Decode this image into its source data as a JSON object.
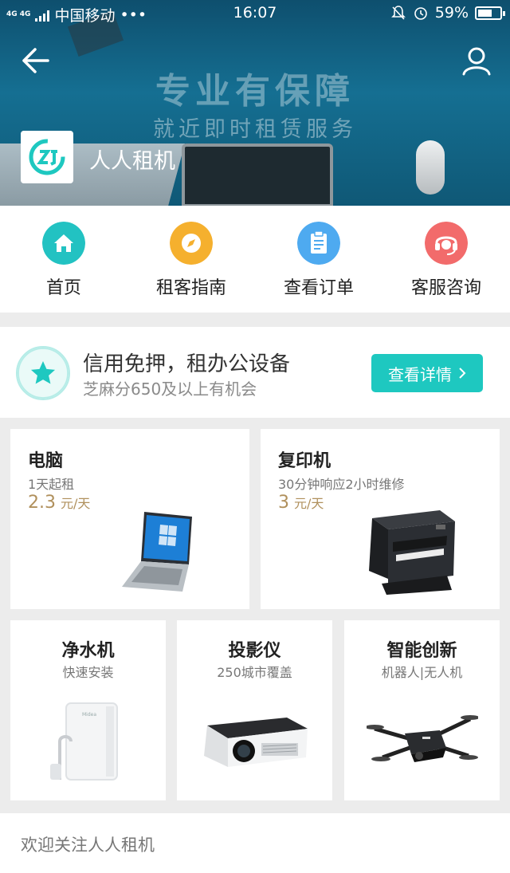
{
  "status_bar": {
    "network": "4G 4G",
    "carrier": "中国移动",
    "dots": "•••",
    "time": "16:07",
    "battery": "59%"
  },
  "banner": {
    "headline": "专业有保障",
    "subline": "就近即时租赁服务",
    "brand_name": "人人租机",
    "colors": {
      "accent": "#1ec8c0",
      "banner": "#156f92"
    }
  },
  "nav": [
    {
      "label": "首页",
      "icon": "home-icon",
      "color": "#22c2c2"
    },
    {
      "label": "租客指南",
      "icon": "compass-icon",
      "color": "#f5b02e"
    },
    {
      "label": "查看订单",
      "icon": "clipboard-icon",
      "color": "#4eaaf0"
    },
    {
      "label": "客服咨询",
      "icon": "headset-icon",
      "color": "#f26b6b"
    }
  ],
  "credit": {
    "title": "信用免押，租办公设备",
    "subtitle": "芝麻分650及以上有机会",
    "button": "查看详情",
    "icon": "star-icon"
  },
  "products": {
    "computer": {
      "title": "电脑",
      "sub": "1天起租",
      "price": "2.3",
      "unit": "元/天",
      "icon": "laptop-icon"
    },
    "copier": {
      "title": "复印机",
      "sub": "30分钟响应2小时维修",
      "price": "3",
      "unit": "元/天",
      "icon": "printer-icon"
    },
    "purifier": {
      "title": "净水机",
      "sub": "快速安装",
      "icon": "water-purifier-icon"
    },
    "projector": {
      "title": "投影仪",
      "sub": "250城市覆盖",
      "icon": "projector-icon"
    },
    "innovation": {
      "title": "智能创新",
      "sub": "机器人|无人机",
      "icon": "drone-icon"
    }
  },
  "footer": {
    "text": "欢迎关注人人租机"
  }
}
